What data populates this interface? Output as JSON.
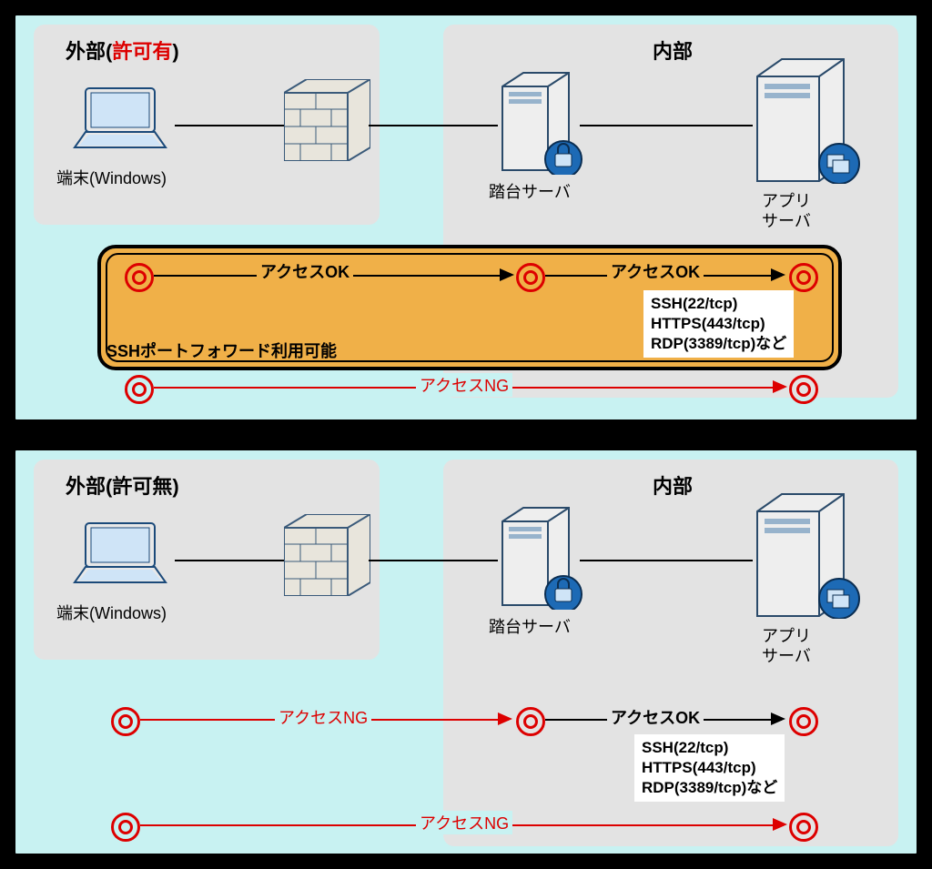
{
  "panels": {
    "top": {
      "ext_prefix": "外部(",
      "ext_red": "許可有",
      "ext_suffix": ")",
      "int_title": "内部",
      "terminal_label": "端末(Windows)",
      "bastion_label": "踏台サーバ",
      "app_label_l1": "アプリ",
      "app_label_l2": "サーバ",
      "flow1_label": "アクセスOK",
      "flow2_label": "アクセスOK",
      "ng_label": "アクセスNG",
      "ssh_fwd": "SSHポートフォワード利用可能",
      "proto1": "SSH(22/tcp)",
      "proto2": "HTTPS(443/tcp)",
      "proto3": "RDP(3389/tcp)など"
    },
    "bottom": {
      "ext_title": "外部(許可無)",
      "int_title": "内部",
      "terminal_label": "端末(Windows)",
      "bastion_label": "踏台サーバ",
      "app_label_l1": "アプリ",
      "app_label_l2": "サーバ",
      "flow1_label": "アクセスNG",
      "flow2_label": "アクセスOK",
      "ng_label": "アクセスNG",
      "proto1": "SSH(22/tcp)",
      "proto2": "HTTPS(443/tcp)",
      "proto3": "RDP(3389/tcp)など"
    }
  }
}
